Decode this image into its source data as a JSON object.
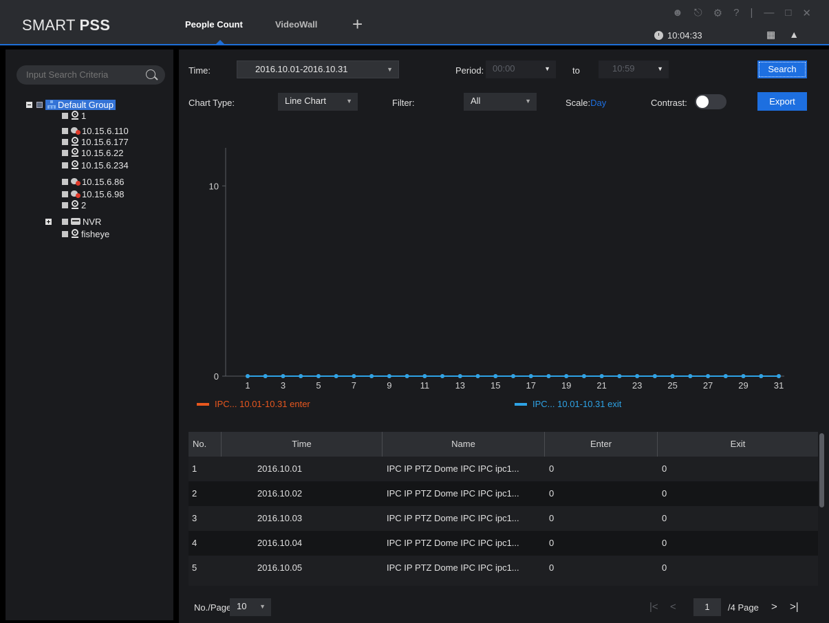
{
  "app": {
    "logo_main": "SMART",
    "logo_bold": "PSS"
  },
  "tabs": [
    {
      "label": "People Count"
    },
    {
      "label": "VideoWall"
    }
  ],
  "clock": {
    "time": "10:04:33"
  },
  "sidebar": {
    "search_placeholder": "Input Search Criteria",
    "tree": {
      "group": "Default Group",
      "items": [
        {
          "label": "1",
          "type": "camera"
        },
        {
          "label": "10.15.6.110",
          "type": "offline"
        },
        {
          "label": "10.15.6.177",
          "type": "camera"
        },
        {
          "label": "10.15.6.22",
          "type": "camera"
        },
        {
          "label": "10.15.6.234",
          "type": "camera"
        },
        {
          "label": "10.15.6.86",
          "type": "offline"
        },
        {
          "label": "10.15.6.98",
          "type": "offline"
        },
        {
          "label": "2",
          "type": "camera"
        }
      ],
      "nvr": "NVR",
      "fisheye": "fisheye"
    }
  },
  "filters": {
    "time_label": "Time:",
    "time_value": "2016.10.01-2016.10.31",
    "period_label": "Period:",
    "period_from": "00:00",
    "to_label": "to",
    "period_to": "10:59",
    "search_label": "Search",
    "chart_type_label": "Chart Type:",
    "chart_type_value": "Line Chart",
    "filter_label": "Filter:",
    "filter_value": "All",
    "scale_label": "Scale:",
    "scale_value": "Day",
    "contrast_label": "Contrast:",
    "contrast_on": false,
    "export_label": "Export"
  },
  "chart_data": {
    "type": "line",
    "x": [
      1,
      2,
      3,
      4,
      5,
      6,
      7,
      8,
      9,
      10,
      11,
      12,
      13,
      14,
      15,
      16,
      17,
      18,
      19,
      20,
      21,
      22,
      23,
      24,
      25,
      26,
      27,
      28,
      29,
      30,
      31
    ],
    "xticks": [
      "1",
      "3",
      "5",
      "7",
      "9",
      "11",
      "13",
      "15",
      "17",
      "19",
      "21",
      "23",
      "25",
      "27",
      "29",
      "31"
    ],
    "yticks": [
      "0",
      "10"
    ],
    "ylim": [
      0,
      12
    ],
    "series": [
      {
        "name": "IPC... 10.01-10.31 enter",
        "color": "#e8571e",
        "values": [
          0,
          0,
          0,
          0,
          0,
          0,
          0,
          0,
          0,
          0,
          0,
          0,
          0,
          0,
          0,
          0,
          0,
          0,
          0,
          0,
          0,
          0,
          0,
          0,
          0,
          0,
          0,
          0,
          0,
          0,
          0
        ]
      },
      {
        "name": "IPC... 10.01-10.31 exit",
        "color": "#2ea3e6",
        "values": [
          0,
          0,
          0,
          0,
          0,
          0,
          0,
          0,
          0,
          0,
          0,
          0,
          0,
          0,
          0,
          0,
          0,
          0,
          0,
          0,
          0,
          0,
          0,
          0,
          0,
          0,
          0,
          0,
          0,
          0,
          0
        ]
      }
    ]
  },
  "table": {
    "headers": [
      "No.",
      "Time",
      "Name",
      "Enter",
      "Exit"
    ],
    "rows": [
      {
        "no": "1",
        "time": "2016.10.01",
        "name": "IPC IP PTZ Dome IPC IPC ipc1...",
        "enter": "0",
        "exit": "0"
      },
      {
        "no": "2",
        "time": "2016.10.02",
        "name": "IPC IP PTZ Dome IPC IPC ipc1...",
        "enter": "0",
        "exit": "0"
      },
      {
        "no": "3",
        "time": "2016.10.03",
        "name": "IPC IP PTZ Dome IPC IPC ipc1...",
        "enter": "0",
        "exit": "0"
      },
      {
        "no": "4",
        "time": "2016.10.04",
        "name": "IPC IP PTZ Dome IPC IPC ipc1...",
        "enter": "0",
        "exit": "0"
      },
      {
        "no": "5",
        "time": "2016.10.05",
        "name": "IPC IP PTZ Dome IPC IPC ipc1...",
        "enter": "0",
        "exit": "0"
      }
    ]
  },
  "pager": {
    "per_page_label": "No./Page",
    "per_page_value": "10",
    "current_page": "1",
    "total_label": "/4 Page"
  }
}
